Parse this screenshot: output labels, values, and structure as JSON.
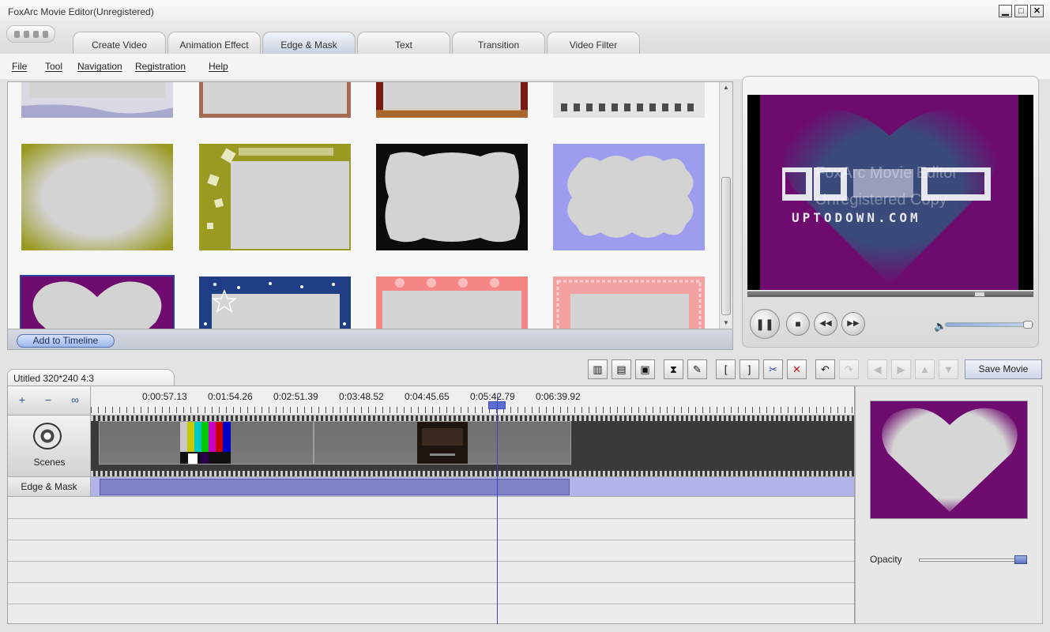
{
  "window": {
    "title": "FoxArc Movie Editor(Unregistered)",
    "buttons": {
      "minimize": "▁",
      "maximize": "□",
      "close": "✕"
    }
  },
  "tabs": [
    {
      "label": "Create Video",
      "active": false
    },
    {
      "label": "Animation Effect",
      "active": false
    },
    {
      "label": "Edge & Mask",
      "active": true
    },
    {
      "label": "Text",
      "active": false
    },
    {
      "label": "Transition",
      "active": false
    },
    {
      "label": "Video Filter",
      "active": false
    }
  ],
  "menu": [
    "File",
    "Tool",
    "Navigation",
    "Registration",
    "Help"
  ],
  "gallery": {
    "add_button": "Add to Timeline",
    "rows": [
      [
        "lavender-wave-frame",
        "brown-border-frame",
        "red-ornate-frame",
        "filmstrip-frame"
      ],
      [
        "olive-soft-edge",
        "olive-music-frame",
        "black-bumpy-frame",
        "blue-cloud-frame"
      ],
      [
        "purple-heart-mask",
        "navy-star-frame",
        "pink-heart-frame",
        "pink-lace-frame"
      ]
    ]
  },
  "preview": {
    "watermark_line1": "FoxArc Movie Editor",
    "watermark_line2": "Unregistered Copy",
    "logo_text": "UPTODOWN.COM",
    "controls": {
      "pause": "❚❚",
      "stop": "■",
      "rewind": "◀◀",
      "forward": "▶▶"
    },
    "volume_icon": "🔈",
    "colors": {
      "mask_purple": "#6e0b6e"
    }
  },
  "project": {
    "tab_label": "Utitled 320*240 4:3",
    "save_button": "Save Movie"
  },
  "toolbar_icons": [
    "film-add-icon",
    "open-icon",
    "save-project-icon",
    "trim-icon",
    "split-icon",
    "mark-in-icon",
    "mark-out-icon",
    "cut-icon",
    "delete-icon",
    "undo-icon",
    "redo-icon",
    "move-left-icon",
    "move-right-icon",
    "move-up-icon",
    "move-down-icon"
  ],
  "timeline": {
    "zoom": {
      "in": "+",
      "out": "−",
      "fit": "∞"
    },
    "ruler_labels": [
      "0:00:57.13",
      "0:01:54.26",
      "0:02:51.39",
      "0:03:48.52",
      "0:04:45.65",
      "0:05:42.79",
      "0:06:39.92"
    ],
    "tracks": {
      "scenes": "Scenes",
      "edge_mask": "Edge & Mask"
    }
  },
  "mask_panel": {
    "opacity_label": "Opacity",
    "opacity_value": 1.0
  }
}
